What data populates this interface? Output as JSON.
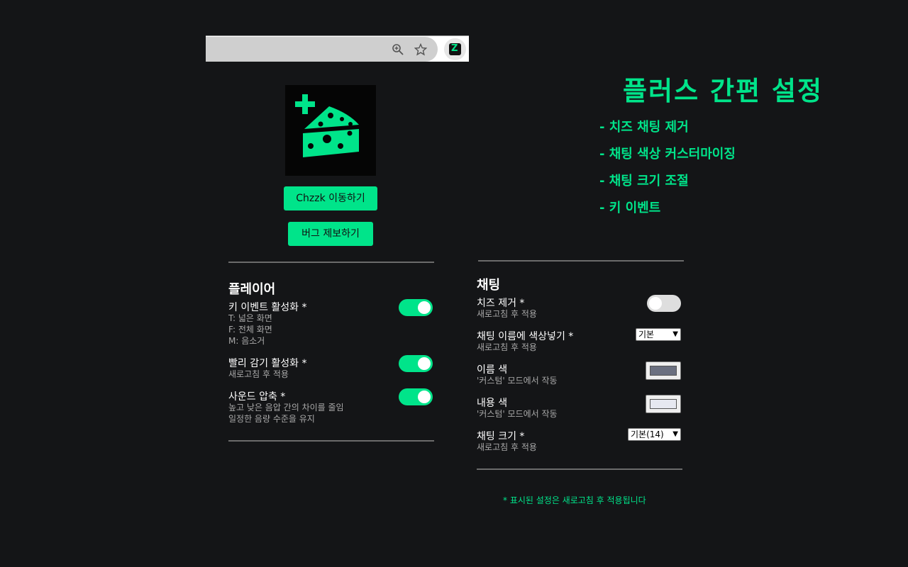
{
  "browser": {
    "icons": [
      "zoom-icon",
      "star-icon",
      "extension-icon"
    ],
    "extension_glyph": "Z"
  },
  "logo": {
    "icon": "cheese-plus-icon",
    "colors": {
      "accent": "#00e48a",
      "background": "#050505"
    }
  },
  "buttons": {
    "chzzk": "Chzzk 이동하기",
    "bug_report": "버그 제보하기"
  },
  "hero": {
    "title": "플러스 간편 설정",
    "features": [
      "- 치즈 채팅 제거",
      "- 채팅 색상 커스터마이징",
      "- 채팅 크기 조절",
      "- 키 이벤트"
    ]
  },
  "player": {
    "title": "플레이어",
    "settings": [
      {
        "label": "키 이벤트 활성화 *",
        "desc": [
          "T: 넓은 화면",
          "F: 전체 화면",
          "M: 음소거"
        ],
        "enabled": true
      },
      {
        "label": "빨리 감기 활성화 *",
        "desc": [
          "새로고침 후 적용"
        ],
        "enabled": true
      },
      {
        "label": "사운드 압축 *",
        "desc": [
          "높고 낮은 음압 간의 차이를 줄임",
          "일정한 음량 수준을 유지"
        ],
        "enabled": true
      }
    ]
  },
  "chat": {
    "title": "채팅",
    "cheese_remove": {
      "label": "치즈 제거 *",
      "desc": "새로고침 후 적용",
      "enabled": false
    },
    "name_color_mode": {
      "label": "채팅 이름에 색상넣기 *",
      "desc": "새로고침 후 적용",
      "value": "기본"
    },
    "name_color": {
      "label": "이름 색",
      "desc": "'커스텀' 모드에서 작동",
      "color": "#6b7080"
    },
    "content_color": {
      "label": "내용 색",
      "desc": "'커스텀' 모드에서 작동",
      "color": "#e6e8f0"
    },
    "chat_size": {
      "label": "채팅 크기 *",
      "desc": "새로고침 후 적용",
      "value": "기본(14)"
    }
  },
  "footnote": "* 표시된 설정은 새로고침 후 적용됩니다",
  "colors": {
    "accent": "#00e48a",
    "background": "#141517",
    "divider": "#6b6b6b"
  }
}
